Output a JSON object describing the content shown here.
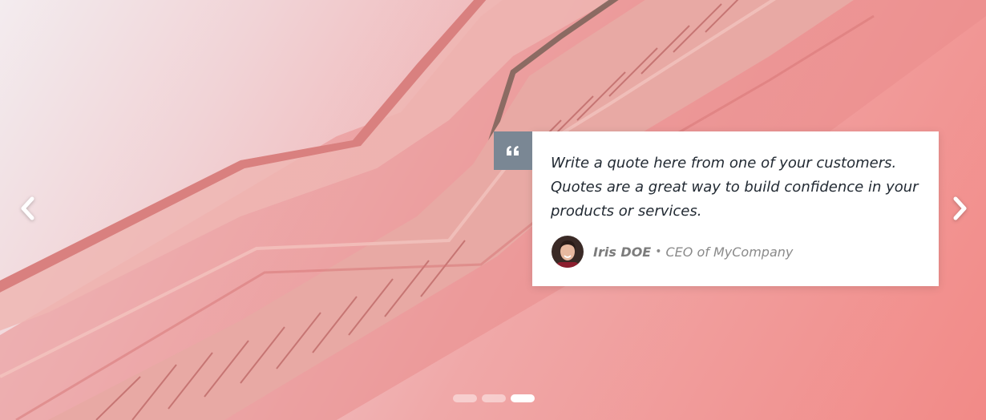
{
  "carousel": {
    "prev_icon": "chevron-left-icon",
    "next_icon": "chevron-right-icon",
    "slide_count": 3,
    "active_slide": 3
  },
  "testimonial": {
    "quote_icon": "quote-icon",
    "quote": "Write a quote here from one of your customers. Quotes are a great way to build confidence in your products or services.",
    "author_name": "Iris DOE",
    "separator": "•",
    "author_role": "CEO of MyCompany"
  },
  "colors": {
    "badge": "#7a8794",
    "card": "#ffffff",
    "accent_background": "#f28a87"
  }
}
